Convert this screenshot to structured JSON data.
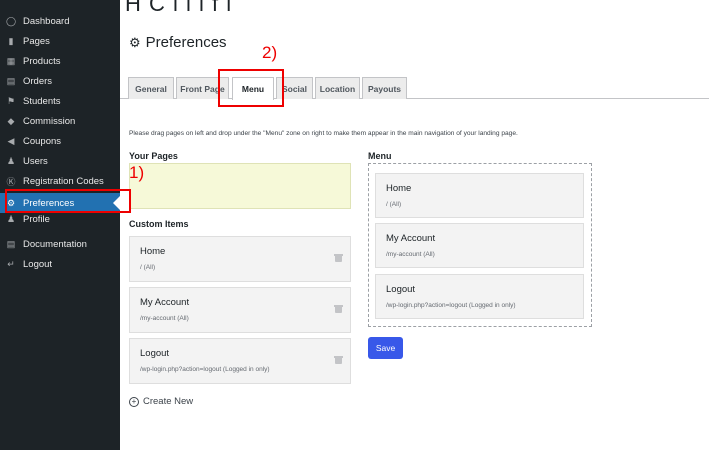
{
  "top_partial_text": "H     C      l                 l   l           f      l      ",
  "sidebar": {
    "items": [
      {
        "label": "Dashboard",
        "icon": "dashboard-icon"
      },
      {
        "label": "Pages",
        "icon": "pages-icon"
      },
      {
        "label": "Products",
        "icon": "products-icon"
      },
      {
        "label": "Orders",
        "icon": "cart-icon"
      },
      {
        "label": "Students",
        "icon": "students-icon"
      },
      {
        "label": "Commission",
        "icon": "tag-icon"
      },
      {
        "label": "Coupons",
        "icon": "coupon-icon"
      },
      {
        "label": "Users",
        "icon": "users-icon"
      },
      {
        "label": "Registration Codes",
        "icon": "dollar-icon"
      },
      {
        "label": "Preferences",
        "icon": "gear-icon"
      },
      {
        "label": "Profile",
        "icon": "profile-icon"
      },
      {
        "label": "Documentation",
        "icon": "document-icon"
      },
      {
        "label": "Logout",
        "icon": "logout-icon"
      }
    ]
  },
  "header": {
    "title": "Preferences"
  },
  "tabs": [
    "General",
    "Front Page",
    "Menu",
    "Social",
    "Location",
    "Payouts"
  ],
  "description": "Please drag pages on left and drop under the \"Menu\" zone on right to make them appear in the main navigation of your landing page.",
  "your_pages": {
    "heading": "Your Pages"
  },
  "custom_items": {
    "heading": "Custom Items",
    "items": [
      {
        "title": "Home",
        "sub": "/ (All)"
      },
      {
        "title": "My Account",
        "sub": "/my-account (All)"
      },
      {
        "title": "Logout",
        "sub": "/wp-login.php?action=logout (Logged in only)"
      }
    ],
    "create_new": "Create New"
  },
  "menu": {
    "heading": "Menu",
    "items": [
      {
        "title": "Home",
        "sub": "/ (All)"
      },
      {
        "title": "My Account",
        "sub": "/my-account (All)"
      },
      {
        "title": "Logout",
        "sub": "/wp-login.php?action=logout (Logged in only)"
      }
    ],
    "save_label": "Save"
  },
  "annotations": {
    "one": "1)",
    "two": "2)"
  },
  "colors": {
    "sidebar_bg": "#1d2327",
    "active": "#2271b1",
    "save": "#3858e9",
    "annotation": "#e00000",
    "dropzone": "#f6f9d8"
  }
}
